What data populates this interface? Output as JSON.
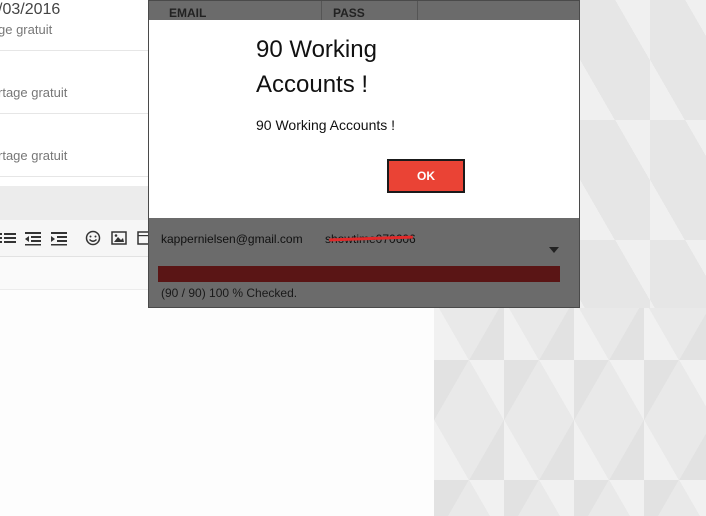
{
  "mail_list": {
    "items": [
      {
        "date": "/03/2016",
        "subject": "ge gratuit"
      },
      {
        "date": "",
        "subject": "rtage gratuit"
      },
      {
        "date": "",
        "subject": "rtage gratuit"
      }
    ]
  },
  "checker": {
    "col_email": "EMAIL",
    "col_pass": "PASS",
    "rows": [
      {
        "email": "kappernielsen@gmail.com",
        "pass": "showtime070606"
      }
    ],
    "progress_fraction": 1.0,
    "status": "(90 / 90) 100 % Checked."
  },
  "modal": {
    "title": "90 Working Accounts !",
    "message": "90 Working Accounts !",
    "ok_label": "OK"
  },
  "colors": {
    "ok_button": "#ea4335",
    "panel": "#6b6b6b",
    "progress": "#5a1515"
  }
}
